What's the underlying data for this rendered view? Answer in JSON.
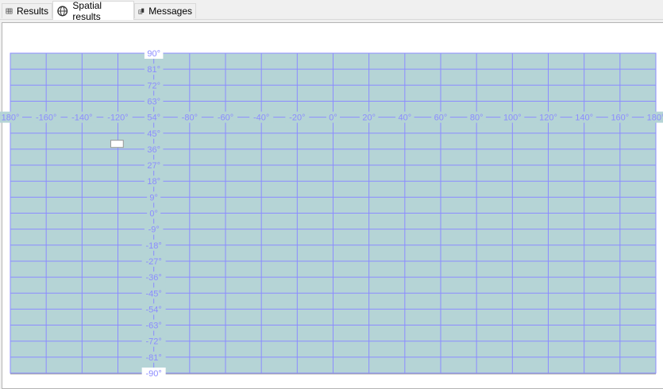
{
  "tabs": [
    {
      "label": "Results",
      "icon": "grid-icon",
      "active": false
    },
    {
      "label": "Spatial results",
      "icon": "globe-icon",
      "active": true
    },
    {
      "label": "Messages",
      "icon": "messages-icon",
      "active": false
    }
  ],
  "map": {
    "background": "#b5d4d6",
    "grid_color": "#8c8cff",
    "longitude_labels": [
      "180°",
      "-160°",
      "-140°",
      "-120°",
      "-80°",
      "-60°",
      "-40°",
      "-20°",
      "0°",
      "20°",
      "40°",
      "60°",
      "80°",
      "100°",
      "120°",
      "140°",
      "160°",
      "180°"
    ],
    "latitude_labels": [
      "90°",
      "81°",
      "72°",
      "63°",
      "54°",
      "45°",
      "36°",
      "27°",
      "18°",
      "9°",
      "0°",
      "-9°",
      "-18°",
      "-27°",
      "-36°",
      "-45°",
      "-54°",
      "-63°",
      "-72°",
      "-81°",
      "-90°"
    ],
    "longitude_range": [
      -180,
      180
    ],
    "latitude_range": [
      -90,
      90
    ],
    "shape": {
      "type": "rectangle",
      "lon": [
        -124,
        -117
      ],
      "lat": [
        37,
        41
      ],
      "fill": "#ffffff"
    }
  }
}
